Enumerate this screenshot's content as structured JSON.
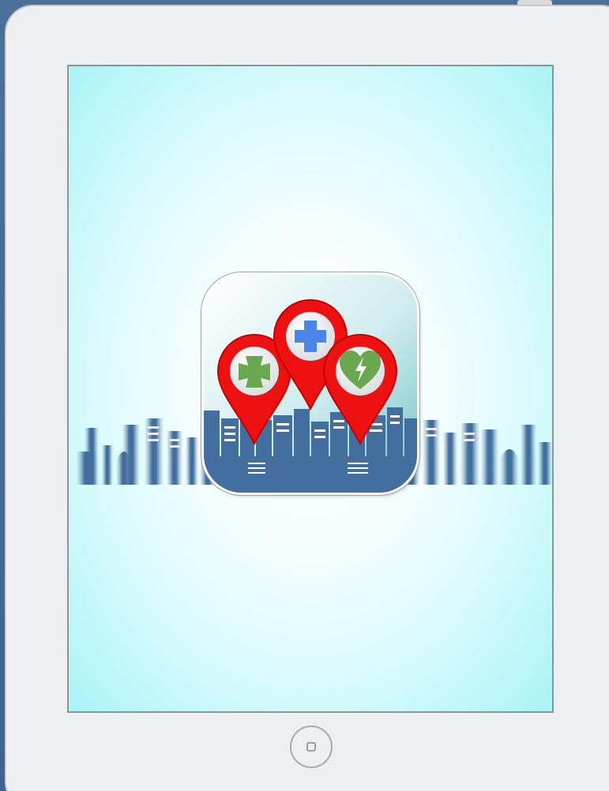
{
  "device": {
    "type": "tablet",
    "frame_color": "#eeeff1",
    "background_color": "#4a6f97"
  },
  "splash_screen": {
    "background_gradient": [
      "#ffffff",
      "#a9f3f6"
    ],
    "skyline_color": "#426f9e"
  },
  "app_icon": {
    "pins": [
      {
        "name": "green-cross-pin",
        "symbol": "green-cross-icon",
        "color": "#6aa84f"
      },
      {
        "name": "medical-cross-pin",
        "symbol": "medical-cross-icon",
        "color": "#4a86e8"
      },
      {
        "name": "heart-defibrillator-pin",
        "symbol": "heart-bolt-icon",
        "color": "#6aa84f"
      }
    ],
    "pin_color": "#ee1111"
  },
  "home_button": {
    "icon": "home-button-icon"
  }
}
